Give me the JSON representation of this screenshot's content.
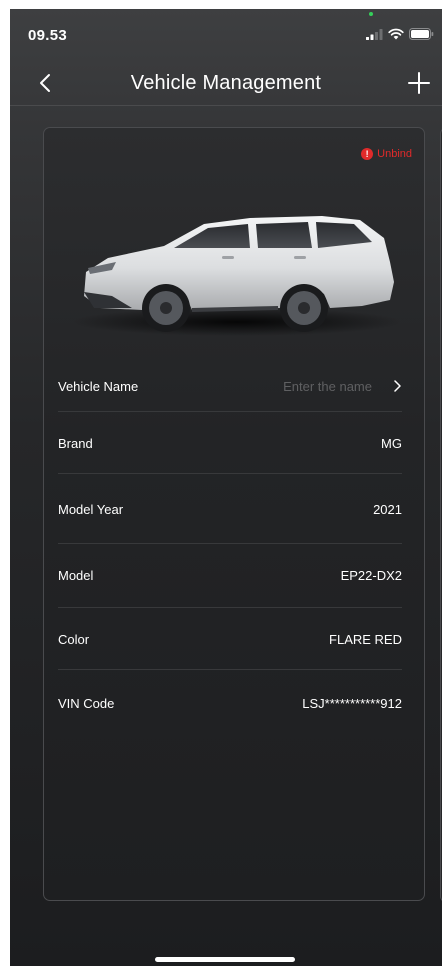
{
  "status_bar": {
    "time": "09.53",
    "icons": [
      "cellular-signal-icon",
      "wifi-icon",
      "battery-icon"
    ]
  },
  "nav": {
    "title": "Vehicle Management",
    "back_icon": "chevron-left-icon",
    "add_icon": "plus-icon"
  },
  "vehicle_card": {
    "unbind_label": "Unbind",
    "accent_color": "#e02a2a",
    "car_image": "white-hatchback-car",
    "rows": [
      {
        "label": "Vehicle Name",
        "placeholder": "Enter the name"
      },
      {
        "label": "Brand",
        "value": "MG"
      },
      {
        "label": "Model Year",
        "value": "2021"
      },
      {
        "label": "Model",
        "value": "EP22-DX2"
      },
      {
        "label": "Color",
        "value": "FLARE RED"
      },
      {
        "label": "VIN Code",
        "value": "LSJ***********912"
      }
    ]
  }
}
